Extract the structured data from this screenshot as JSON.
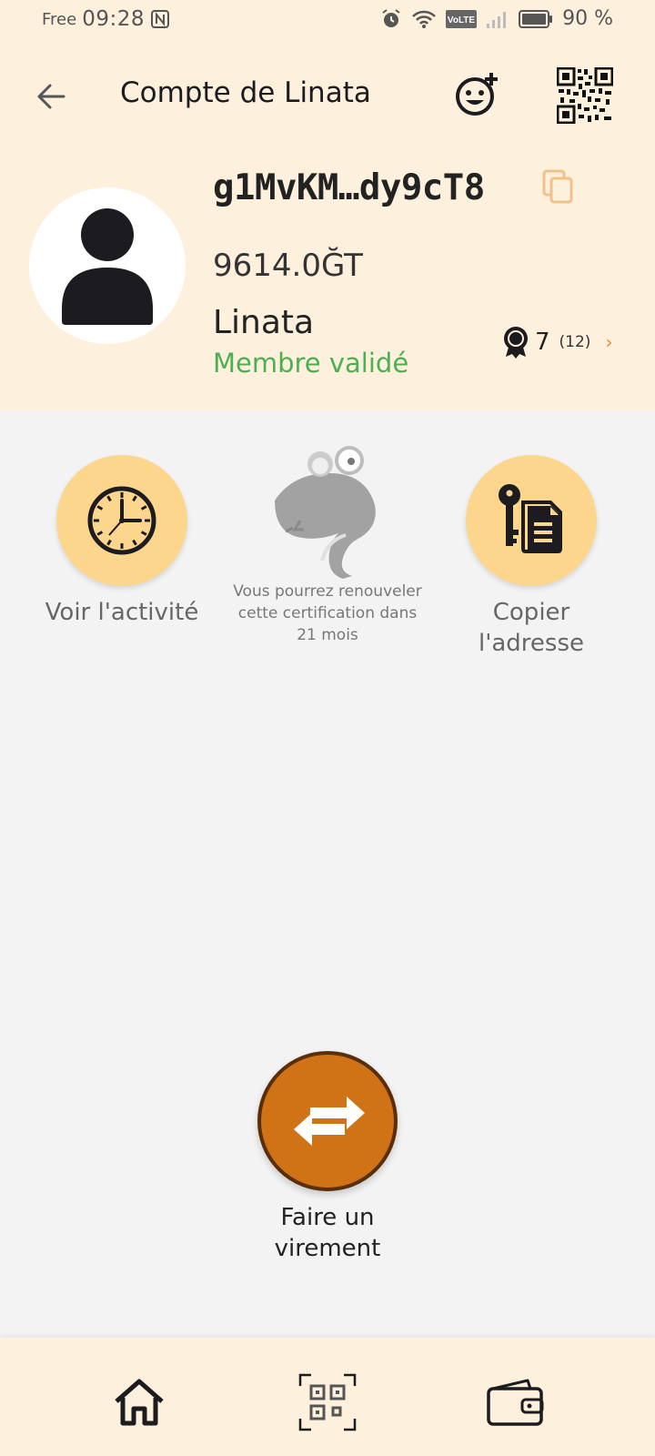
{
  "status_bar": {
    "carrier": "Free",
    "time": "09:28",
    "battery": "90 %",
    "icons": [
      "nfc-icon",
      "alarm-icon",
      "wifi-icon",
      "volte-icon",
      "signal-icon",
      "battery-icon"
    ]
  },
  "header": {
    "title": "Compte de Linata",
    "icons": {
      "back": "arrow-left-icon",
      "add_contact": "add-contact-icon",
      "qr": "qr-code-icon"
    }
  },
  "profile": {
    "address": "g1MvKM…dy9cT8",
    "balance": "9614.0ĞT",
    "name": "Linata",
    "status": "Membre validé",
    "certifications": "7",
    "certifications_total": "(12)",
    "status_color": "#4caf50"
  },
  "actions": {
    "history_label": "Voir l'activité",
    "copy_label": "Copier l'adresse",
    "certify_note": "Vous pourrez renouveler cette certification dans 21 mois"
  },
  "transfer": {
    "label": "Faire un virement",
    "color": "#d07216"
  },
  "bottom_nav": {
    "items": [
      "home-icon",
      "qr-scan-icon",
      "wallet-icon"
    ]
  },
  "colors": {
    "header_bg": "#fdf0dc",
    "accent_light": "#fdd68e",
    "accent": "#d07216"
  }
}
